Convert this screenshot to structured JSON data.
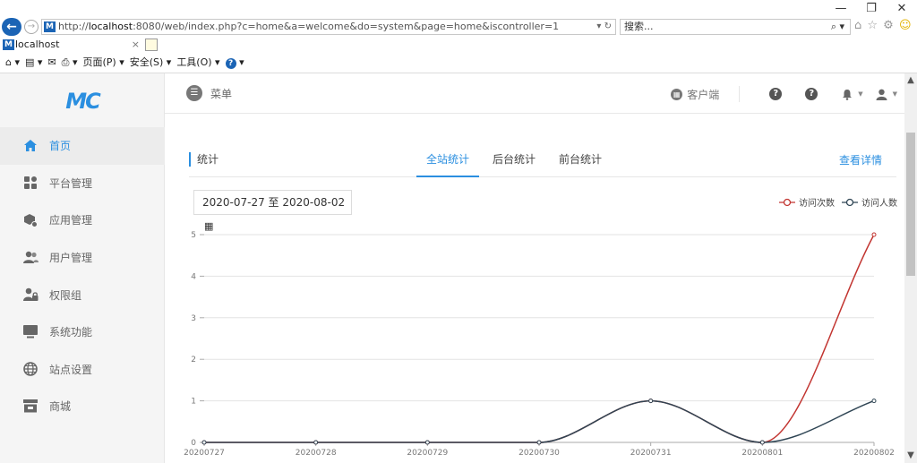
{
  "browser": {
    "window_controls": {
      "minimize": "—",
      "restore": "❐",
      "close": "✕"
    },
    "address": {
      "prefix": "http://",
      "host": "localhost",
      "rest": ":8080/web/index.php?c=home&a=welcome&do=system&page=home&iscontroller=1",
      "tools": "▾ ↻"
    },
    "search": {
      "placeholder": "搜索...",
      "icon": "⌕ ▾"
    },
    "right_icons": "⌂ ☆ ⚙",
    "tab": {
      "title": "localhost",
      "close": "×"
    },
    "command_bar": {
      "home": "⌂ ▾",
      "feeds": "▤ ▾",
      "mail": "✉",
      "print": "⎙ ▾",
      "page": "页面(P) ▾",
      "safety": "安全(S) ▾",
      "tools": "工具(O) ▾",
      "help": "? ▾"
    }
  },
  "app": {
    "logo": "MC",
    "menu_toggle": "菜单",
    "topbar": {
      "client": "客户端"
    },
    "sidebar": {
      "items": [
        {
          "label": "首页",
          "icon": "home-icon",
          "active": true
        },
        {
          "label": "平台管理",
          "icon": "grid-icon",
          "active": false
        },
        {
          "label": "应用管理",
          "icon": "app-icon",
          "active": false
        },
        {
          "label": "用户管理",
          "icon": "users-icon",
          "active": false
        },
        {
          "label": "权限组",
          "icon": "user-lock-icon",
          "active": false
        },
        {
          "label": "系统功能",
          "icon": "monitor-icon",
          "active": false
        },
        {
          "label": "站点设置",
          "icon": "globe-icon",
          "active": false
        },
        {
          "label": "商城",
          "icon": "shop-icon",
          "active": false
        }
      ]
    },
    "stats": {
      "title": "统计",
      "tabs": [
        "全站统计",
        "后台统计",
        "前台统计"
      ],
      "active_tab": 0,
      "detail_link": "查看详情",
      "date_range": "2020-07-27 至 2020-08-02"
    }
  },
  "chart_data": {
    "type": "line",
    "x": [
      "20200727",
      "20200728",
      "20200729",
      "20200730",
      "20200731",
      "20200801",
      "20200802"
    ],
    "series": [
      {
        "name": "访问次数",
        "values": [
          0,
          0,
          0,
          0,
          1,
          0,
          5
        ],
        "color": "#c23531"
      },
      {
        "name": "访问人数",
        "values": [
          0,
          0,
          0,
          0,
          1,
          0,
          1
        ],
        "color": "#2f4554"
      }
    ],
    "ylim": [
      0,
      5
    ],
    "yticks": [
      0,
      1,
      2,
      3,
      4,
      5
    ],
    "grid": true,
    "legend": "top-right",
    "smooth": true
  }
}
